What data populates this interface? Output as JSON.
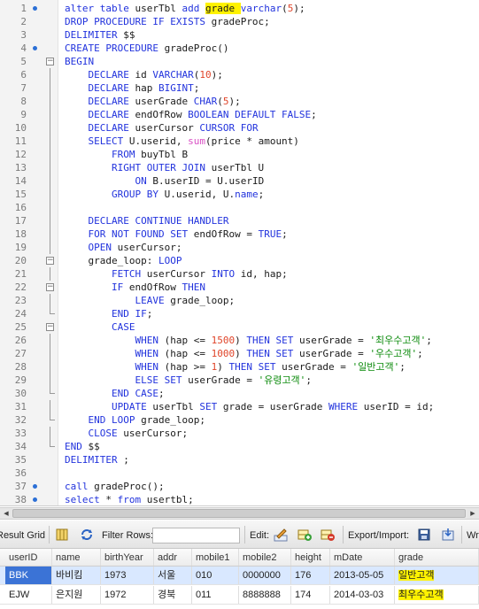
{
  "editor": {
    "lines": [
      {
        "num": "1",
        "bp": true,
        "fold": "",
        "tokens": [
          [
            "kw",
            "alter table "
          ],
          [
            "id",
            "userTbl "
          ],
          [
            "kw",
            "add "
          ],
          [
            "mark",
            "grade "
          ],
          [
            "kw",
            "varchar"
          ],
          [
            "id",
            "("
          ],
          [
            "num",
            "5"
          ],
          [
            "id",
            ");"
          ]
        ]
      },
      {
        "num": "2",
        "bp": false,
        "fold": "",
        "tokens": [
          [
            "kw",
            "DROP PROCEDURE IF EXISTS "
          ],
          [
            "id",
            "gradeProc;"
          ]
        ]
      },
      {
        "num": "3",
        "bp": false,
        "fold": "",
        "tokens": [
          [
            "kw",
            "DELIMITER "
          ],
          [
            "id",
            "$$"
          ]
        ]
      },
      {
        "num": "4",
        "bp": true,
        "fold": "",
        "tokens": [
          [
            "kw",
            "CREATE PROCEDURE "
          ],
          [
            "id",
            "gradeProc()"
          ]
        ]
      },
      {
        "num": "5",
        "bp": false,
        "fold": "open",
        "tokens": [
          [
            "kw",
            "BEGIN"
          ]
        ]
      },
      {
        "num": "6",
        "bp": false,
        "fold": "line",
        "tokens": [
          [
            "id",
            "    "
          ],
          [
            "kw",
            "DECLARE "
          ],
          [
            "id",
            "id "
          ],
          [
            "kw",
            "VARCHAR"
          ],
          [
            "id",
            "("
          ],
          [
            "num",
            "10"
          ],
          [
            "id",
            ");"
          ]
        ]
      },
      {
        "num": "7",
        "bp": false,
        "fold": "line",
        "tokens": [
          [
            "id",
            "    "
          ],
          [
            "kw",
            "DECLARE "
          ],
          [
            "id",
            "hap "
          ],
          [
            "kw",
            "BIGINT"
          ],
          [
            "id",
            ";"
          ]
        ]
      },
      {
        "num": "8",
        "bp": false,
        "fold": "line",
        "tokens": [
          [
            "id",
            "    "
          ],
          [
            "kw",
            "DECLARE "
          ],
          [
            "id",
            "userGrade "
          ],
          [
            "kw",
            "CHAR"
          ],
          [
            "id",
            "("
          ],
          [
            "num",
            "5"
          ],
          [
            "id",
            ");"
          ]
        ]
      },
      {
        "num": "9",
        "bp": false,
        "fold": "line",
        "tokens": [
          [
            "id",
            "    "
          ],
          [
            "kw",
            "DECLARE "
          ],
          [
            "id",
            "endOfRow "
          ],
          [
            "kw",
            "BOOLEAN DEFAULT FALSE"
          ],
          [
            "id",
            ";"
          ]
        ]
      },
      {
        "num": "10",
        "bp": false,
        "fold": "line",
        "tokens": [
          [
            "id",
            "    "
          ],
          [
            "kw",
            "DECLARE "
          ],
          [
            "id",
            "userCursor "
          ],
          [
            "kw",
            "CURSOR FOR"
          ]
        ]
      },
      {
        "num": "11",
        "bp": false,
        "fold": "line",
        "tokens": [
          [
            "id",
            "    "
          ],
          [
            "kw",
            "SELECT "
          ],
          [
            "id",
            "U.userid, "
          ],
          [
            "fn",
            "sum"
          ],
          [
            "id",
            "(price * amount)"
          ]
        ]
      },
      {
        "num": "12",
        "bp": false,
        "fold": "line",
        "tokens": [
          [
            "id",
            "        "
          ],
          [
            "kw",
            "FROM "
          ],
          [
            "id",
            "buyTbl B"
          ]
        ]
      },
      {
        "num": "13",
        "bp": false,
        "fold": "line",
        "tokens": [
          [
            "id",
            "        "
          ],
          [
            "kw",
            "RIGHT OUTER JOIN "
          ],
          [
            "id",
            "userTbl U"
          ]
        ]
      },
      {
        "num": "14",
        "bp": false,
        "fold": "line",
        "tokens": [
          [
            "id",
            "            "
          ],
          [
            "kw",
            "ON "
          ],
          [
            "id",
            "B.userID = U.userID"
          ]
        ]
      },
      {
        "num": "15",
        "bp": false,
        "fold": "line",
        "tokens": [
          [
            "id",
            "        "
          ],
          [
            "kw",
            "GROUP BY "
          ],
          [
            "id",
            "U.userid, U."
          ],
          [
            "kw",
            "name"
          ],
          [
            "id",
            ";"
          ]
        ]
      },
      {
        "num": "16",
        "bp": false,
        "fold": "line",
        "tokens": []
      },
      {
        "num": "17",
        "bp": false,
        "fold": "line",
        "tokens": [
          [
            "id",
            "    "
          ],
          [
            "kw",
            "DECLARE CONTINUE HANDLER"
          ]
        ]
      },
      {
        "num": "18",
        "bp": false,
        "fold": "line",
        "tokens": [
          [
            "id",
            "    "
          ],
          [
            "kw",
            "FOR NOT FOUND SET "
          ],
          [
            "id",
            "endOfRow = "
          ],
          [
            "kw",
            "TRUE"
          ],
          [
            "id",
            ";"
          ]
        ]
      },
      {
        "num": "19",
        "bp": false,
        "fold": "line",
        "tokens": [
          [
            "id",
            "    "
          ],
          [
            "kw",
            "OPEN "
          ],
          [
            "id",
            "userCursor;"
          ]
        ]
      },
      {
        "num": "20",
        "bp": false,
        "fold": "open",
        "tokens": [
          [
            "id",
            "    grade_loop: "
          ],
          [
            "kw",
            "LOOP"
          ]
        ]
      },
      {
        "num": "21",
        "bp": false,
        "fold": "line",
        "tokens": [
          [
            "id",
            "        "
          ],
          [
            "kw",
            "FETCH "
          ],
          [
            "id",
            "userCursor "
          ],
          [
            "kw",
            "INTO "
          ],
          [
            "id",
            "id, hap;"
          ]
        ]
      },
      {
        "num": "22",
        "bp": false,
        "fold": "open",
        "tokens": [
          [
            "id",
            "        "
          ],
          [
            "kw",
            "IF "
          ],
          [
            "id",
            "endOfRow "
          ],
          [
            "kw",
            "THEN"
          ]
        ]
      },
      {
        "num": "23",
        "bp": false,
        "fold": "line",
        "tokens": [
          [
            "id",
            "            "
          ],
          [
            "kw",
            "LEAVE "
          ],
          [
            "id",
            "grade_loop;"
          ]
        ]
      },
      {
        "num": "24",
        "bp": false,
        "fold": "end",
        "tokens": [
          [
            "id",
            "        "
          ],
          [
            "kw",
            "END IF"
          ],
          [
            "id",
            ";"
          ]
        ]
      },
      {
        "num": "25",
        "bp": false,
        "fold": "open",
        "tokens": [
          [
            "id",
            "        "
          ],
          [
            "kw",
            "CASE"
          ]
        ]
      },
      {
        "num": "26",
        "bp": false,
        "fold": "line",
        "tokens": [
          [
            "id",
            "            "
          ],
          [
            "kw",
            "WHEN "
          ],
          [
            "id",
            "(hap <= "
          ],
          [
            "num",
            "1500"
          ],
          [
            "id",
            ") "
          ],
          [
            "kw",
            "THEN SET "
          ],
          [
            "id",
            "userGrade = "
          ],
          [
            "str",
            "'최우수고객'"
          ],
          [
            "id",
            ";"
          ]
        ]
      },
      {
        "num": "27",
        "bp": false,
        "fold": "line",
        "tokens": [
          [
            "id",
            "            "
          ],
          [
            "kw",
            "WHEN "
          ],
          [
            "id",
            "(hap <= "
          ],
          [
            "num",
            "1000"
          ],
          [
            "id",
            ") "
          ],
          [
            "kw",
            "THEN SET "
          ],
          [
            "id",
            "userGrade = "
          ],
          [
            "str",
            "'우수고객'"
          ],
          [
            "id",
            ";"
          ]
        ]
      },
      {
        "num": "28",
        "bp": false,
        "fold": "line",
        "tokens": [
          [
            "id",
            "            "
          ],
          [
            "kw",
            "WHEN "
          ],
          [
            "id",
            "(hap >= "
          ],
          [
            "num",
            "1"
          ],
          [
            "id",
            ") "
          ],
          [
            "kw",
            "THEN SET "
          ],
          [
            "id",
            "userGrade = "
          ],
          [
            "str",
            "'일반고객'"
          ],
          [
            "id",
            ";"
          ]
        ]
      },
      {
        "num": "29",
        "bp": false,
        "fold": "line",
        "tokens": [
          [
            "id",
            "            "
          ],
          [
            "kw",
            "ELSE SET "
          ],
          [
            "id",
            "userGrade = "
          ],
          [
            "str",
            "'유령고객'"
          ],
          [
            "id",
            ";"
          ]
        ]
      },
      {
        "num": "30",
        "bp": false,
        "fold": "end",
        "tokens": [
          [
            "id",
            "        "
          ],
          [
            "kw",
            "END CASE"
          ],
          [
            "id",
            ";"
          ]
        ]
      },
      {
        "num": "31",
        "bp": false,
        "fold": "line",
        "tokens": [
          [
            "id",
            "        "
          ],
          [
            "kw",
            "UPDATE "
          ],
          [
            "id",
            "userTbl "
          ],
          [
            "kw",
            "SET "
          ],
          [
            "id",
            "grade = userGrade "
          ],
          [
            "kw",
            "WHERE "
          ],
          [
            "id",
            "userID = id;"
          ]
        ]
      },
      {
        "num": "32",
        "bp": false,
        "fold": "end",
        "tokens": [
          [
            "id",
            "    "
          ],
          [
            "kw",
            "END LOOP "
          ],
          [
            "id",
            "grade_loop;"
          ]
        ]
      },
      {
        "num": "33",
        "bp": false,
        "fold": "line",
        "tokens": [
          [
            "id",
            "    "
          ],
          [
            "kw",
            "CLOSE "
          ],
          [
            "id",
            "userCursor;"
          ]
        ]
      },
      {
        "num": "34",
        "bp": false,
        "fold": "end",
        "tokens": [
          [
            "kw",
            "END "
          ],
          [
            "id",
            "$$"
          ]
        ]
      },
      {
        "num": "35",
        "bp": false,
        "fold": "",
        "tokens": [
          [
            "kw",
            "DELIMITER "
          ],
          [
            "id",
            ";"
          ]
        ]
      },
      {
        "num": "36",
        "bp": false,
        "fold": "",
        "tokens": []
      },
      {
        "num": "37",
        "bp": true,
        "fold": "",
        "tokens": [
          [
            "kw",
            "call "
          ],
          [
            "id",
            "gradeProc();"
          ]
        ]
      },
      {
        "num": "38",
        "bp": true,
        "fold": "",
        "tokens": [
          [
            "kw",
            "select "
          ],
          [
            "id",
            "* "
          ],
          [
            "kw",
            "from "
          ],
          [
            "id",
            "usertbl;"
          ]
        ]
      }
    ]
  },
  "toolbar": {
    "result_grid_label": "Result Grid",
    "filter_rows_label": "Filter Rows:",
    "filter_value": "",
    "edit_label": "Edit:",
    "export_import_label": "Export/Import:",
    "wrap_label": "Wr"
  },
  "grid": {
    "columns": [
      "userID",
      "name",
      "birthYear",
      "addr",
      "mobile1",
      "mobile2",
      "height",
      "mDate",
      "grade"
    ],
    "rows": [
      [
        "BBK",
        "바비킴",
        "1973",
        "서울",
        "010",
        "0000000",
        "176",
        "2013-05-05",
        "일반고객"
      ],
      [
        "EJW",
        "은지원",
        "1972",
        "경북",
        "011",
        "8888888",
        "174",
        "2014-03-03",
        "최우수고객"
      ]
    ],
    "selected_row": 0
  },
  "colors": {
    "keyword": "#2233dd",
    "function": "#d94fc4",
    "number": "#e0452a",
    "string": "#0a8a0a",
    "highlight": "#fff200",
    "selection": "#3b73d6"
  }
}
